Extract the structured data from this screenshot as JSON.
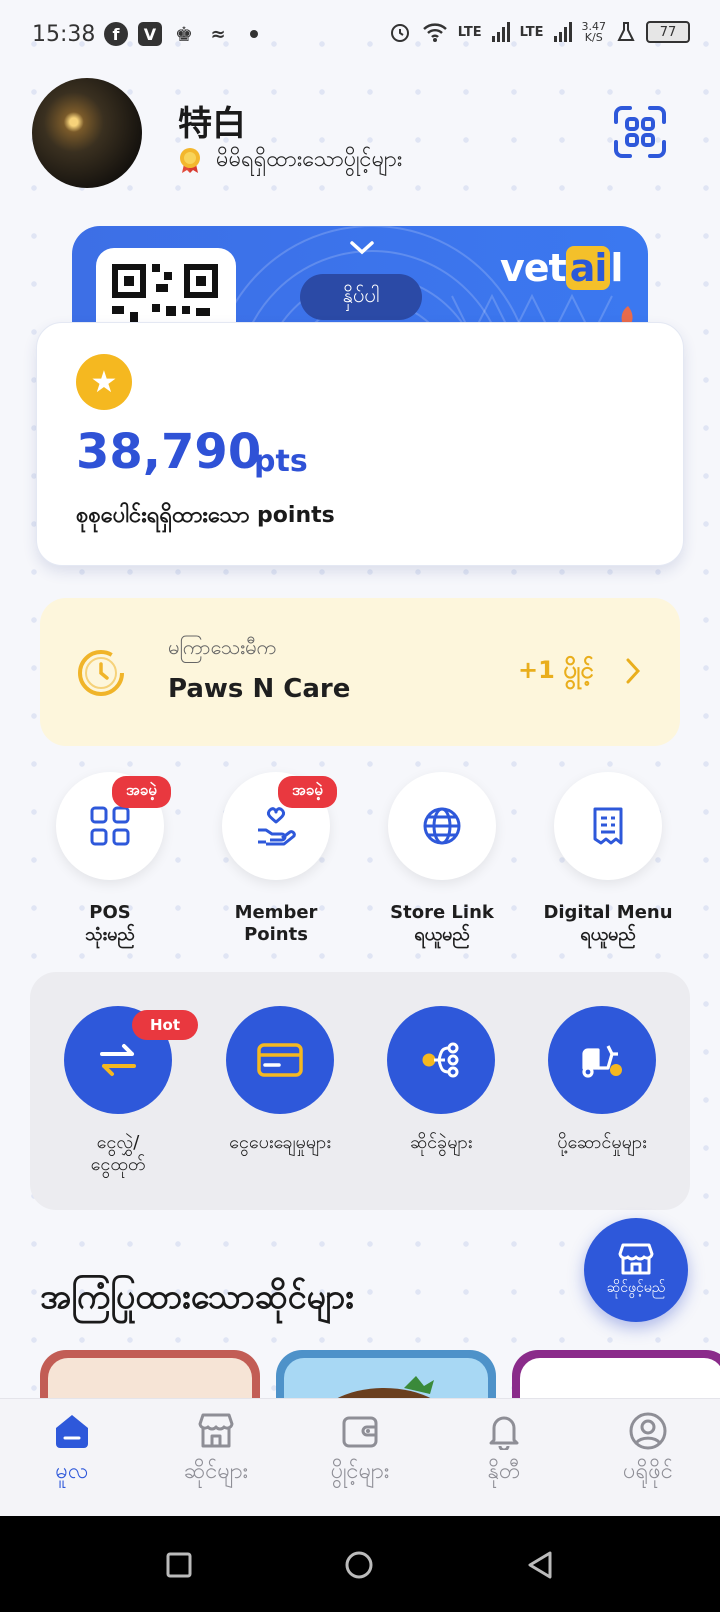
{
  "status_bar": {
    "time": "15:38",
    "app_icons": [
      "facebook-icon",
      "viber-icon",
      "teams-icon",
      "zalo-icon"
    ],
    "network_1": "LTE",
    "network_2": "LTE",
    "speed_value": "3.47",
    "speed_unit": "K/S",
    "battery": "77"
  },
  "profile": {
    "name": "特白",
    "subtitle": "မိမိရရှိထားသောပွိုင့်များ"
  },
  "member_card": {
    "press_label": "နှိပ်ပါ",
    "brand_prefix": "vet",
    "brand_highlight": "ai",
    "brand_suffix": "l"
  },
  "points": {
    "value": "38,790",
    "unit": "pts",
    "label": "စုစုပေါင်းရရှိထားသော points"
  },
  "recent_visit": {
    "caption": "မကြာသေးမီက",
    "store": "Paws N Care",
    "bonus": "+1 ပွိုင့်"
  },
  "features": [
    {
      "line1": "POS",
      "line2": "သုံးမည်",
      "tag": "အခမဲ့"
    },
    {
      "line1": "Member",
      "line2": "Points",
      "tag": "အခမဲ့"
    },
    {
      "line1": "Store Link",
      "line2": "ရယူမည်",
      "tag": ""
    },
    {
      "line1": "Digital Menu",
      "line2": "ရယူမည်",
      "tag": ""
    }
  ],
  "services": [
    {
      "line1": "ငွေလွှဲ/",
      "line2": "ငွေထုတ်",
      "tag": "Hot"
    },
    {
      "line1": "ငွေပေးချေမှုများ",
      "line2": "",
      "tag": ""
    },
    {
      "line1": "ဆိုင်ခွဲများ",
      "line2": "",
      "tag": ""
    },
    {
      "line1": "ပို့ဆောင်မှုများ",
      "line2": "",
      "tag": ""
    }
  ],
  "featured": {
    "title": "အကြံပြုထားသောဆိုင်များ",
    "fab_label": "ဆိုင်ဖွင့်မည်"
  },
  "bottom_nav": [
    {
      "label": "မူလ",
      "icon": "home-icon",
      "active": true
    },
    {
      "label": "ဆိုင်များ",
      "icon": "store-icon",
      "active": false
    },
    {
      "label": "ပွိုင့်များ",
      "icon": "wallet-icon",
      "active": false
    },
    {
      "label": "နိုတီ",
      "icon": "bell-icon",
      "active": false
    },
    {
      "label": "ပရိုဖိုင်",
      "icon": "profile-icon",
      "active": false
    }
  ],
  "colors": {
    "primary": "#2e58da",
    "accent_yellow": "#f5b820",
    "tag_red": "#e9383f",
    "recent_bg": "#fdf6dc"
  }
}
